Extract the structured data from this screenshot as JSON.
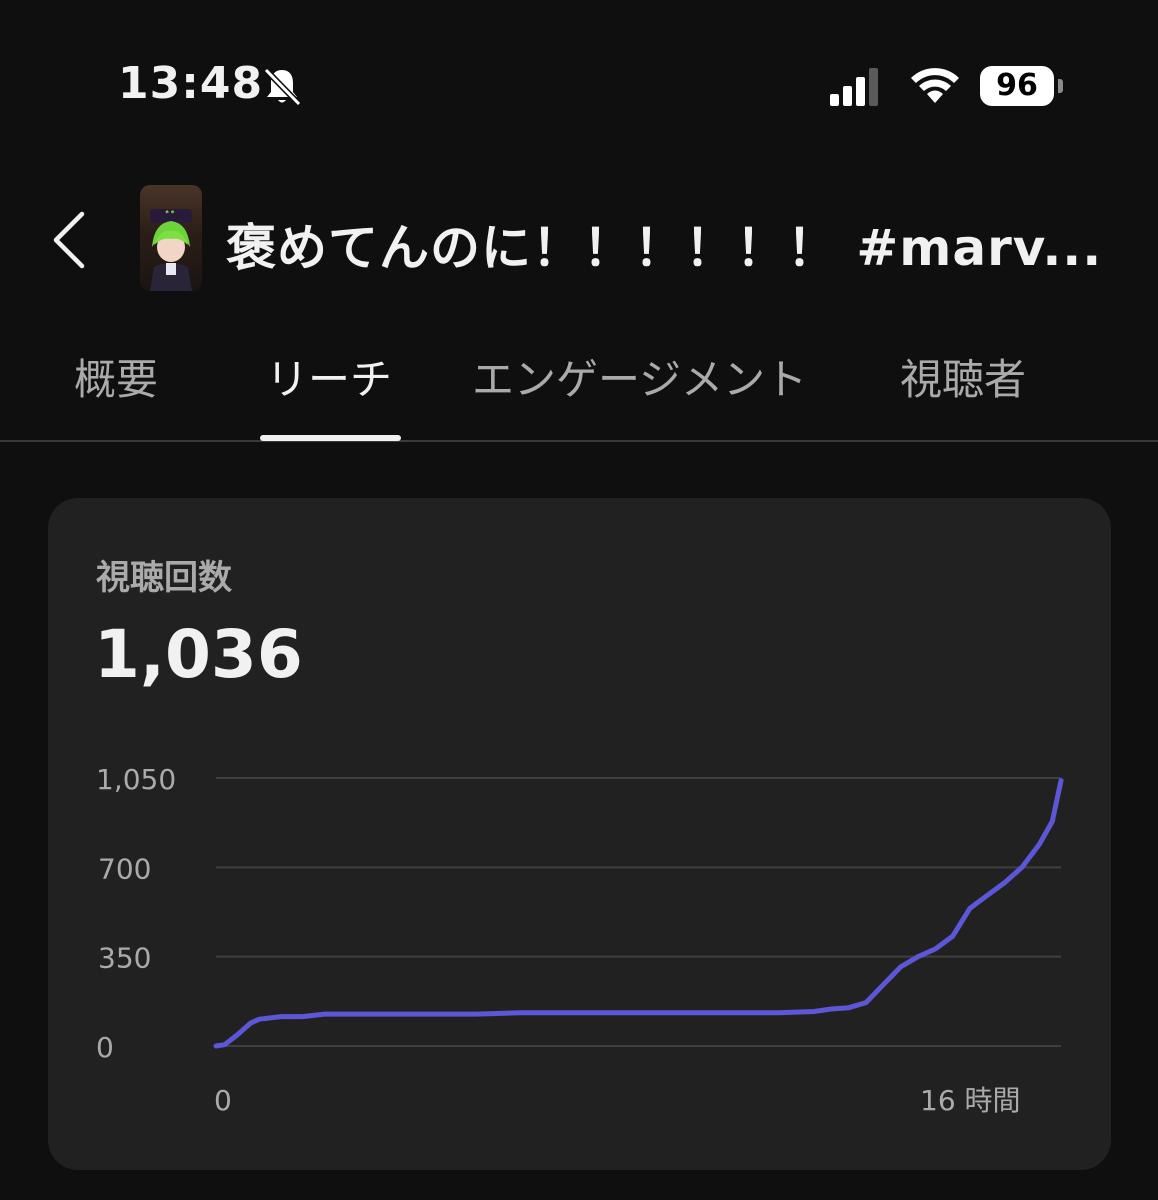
{
  "status": {
    "time": "13:48",
    "battery": "96"
  },
  "header": {
    "title": "褒めてんのに！！！！！！ #marv..."
  },
  "tabs": [
    {
      "label": "概要"
    },
    {
      "label": "リーチ"
    },
    {
      "label": "エンゲージメント"
    },
    {
      "label": "視聴者"
    }
  ],
  "card": {
    "metric_label": "視聴回数",
    "metric_value": "1,036"
  },
  "colors": {
    "line": "#5b57d6",
    "grid": "#3f3f3f",
    "axis_text": "#aaaaaa"
  },
  "chart_data": {
    "type": "line",
    "y_ticks": [
      "1,050",
      "700",
      "350",
      "0"
    ],
    "x_tick_labels": [
      "0",
      "16 時間"
    ],
    "ylim": [
      0,
      1050
    ],
    "xlim": [
      0,
      19.5
    ],
    "grid": true,
    "series": [
      {
        "x": [
          0,
          0.2,
          0.5,
          0.8,
          1.0,
          1.5,
          2.0,
          2.5,
          3.0,
          4.0,
          5.0,
          6.0,
          7.0,
          8.0,
          9.0,
          10.0,
          11.0,
          12.0,
          13.0,
          13.8,
          14.2,
          14.6,
          15.0,
          15.4,
          15.8,
          16.2,
          16.6,
          17.0,
          17.4,
          17.8,
          18.2,
          18.6,
          19.0,
          19.3,
          19.5
        ],
        "y": [
          0,
          5,
          45,
          90,
          105,
          115,
          115,
          125,
          125,
          125,
          125,
          125,
          130,
          130,
          130,
          130,
          130,
          130,
          130,
          135,
          145,
          150,
          170,
          240,
          310,
          350,
          380,
          430,
          540,
          590,
          640,
          700,
          790,
          880,
          1040
        ]
      }
    ]
  }
}
